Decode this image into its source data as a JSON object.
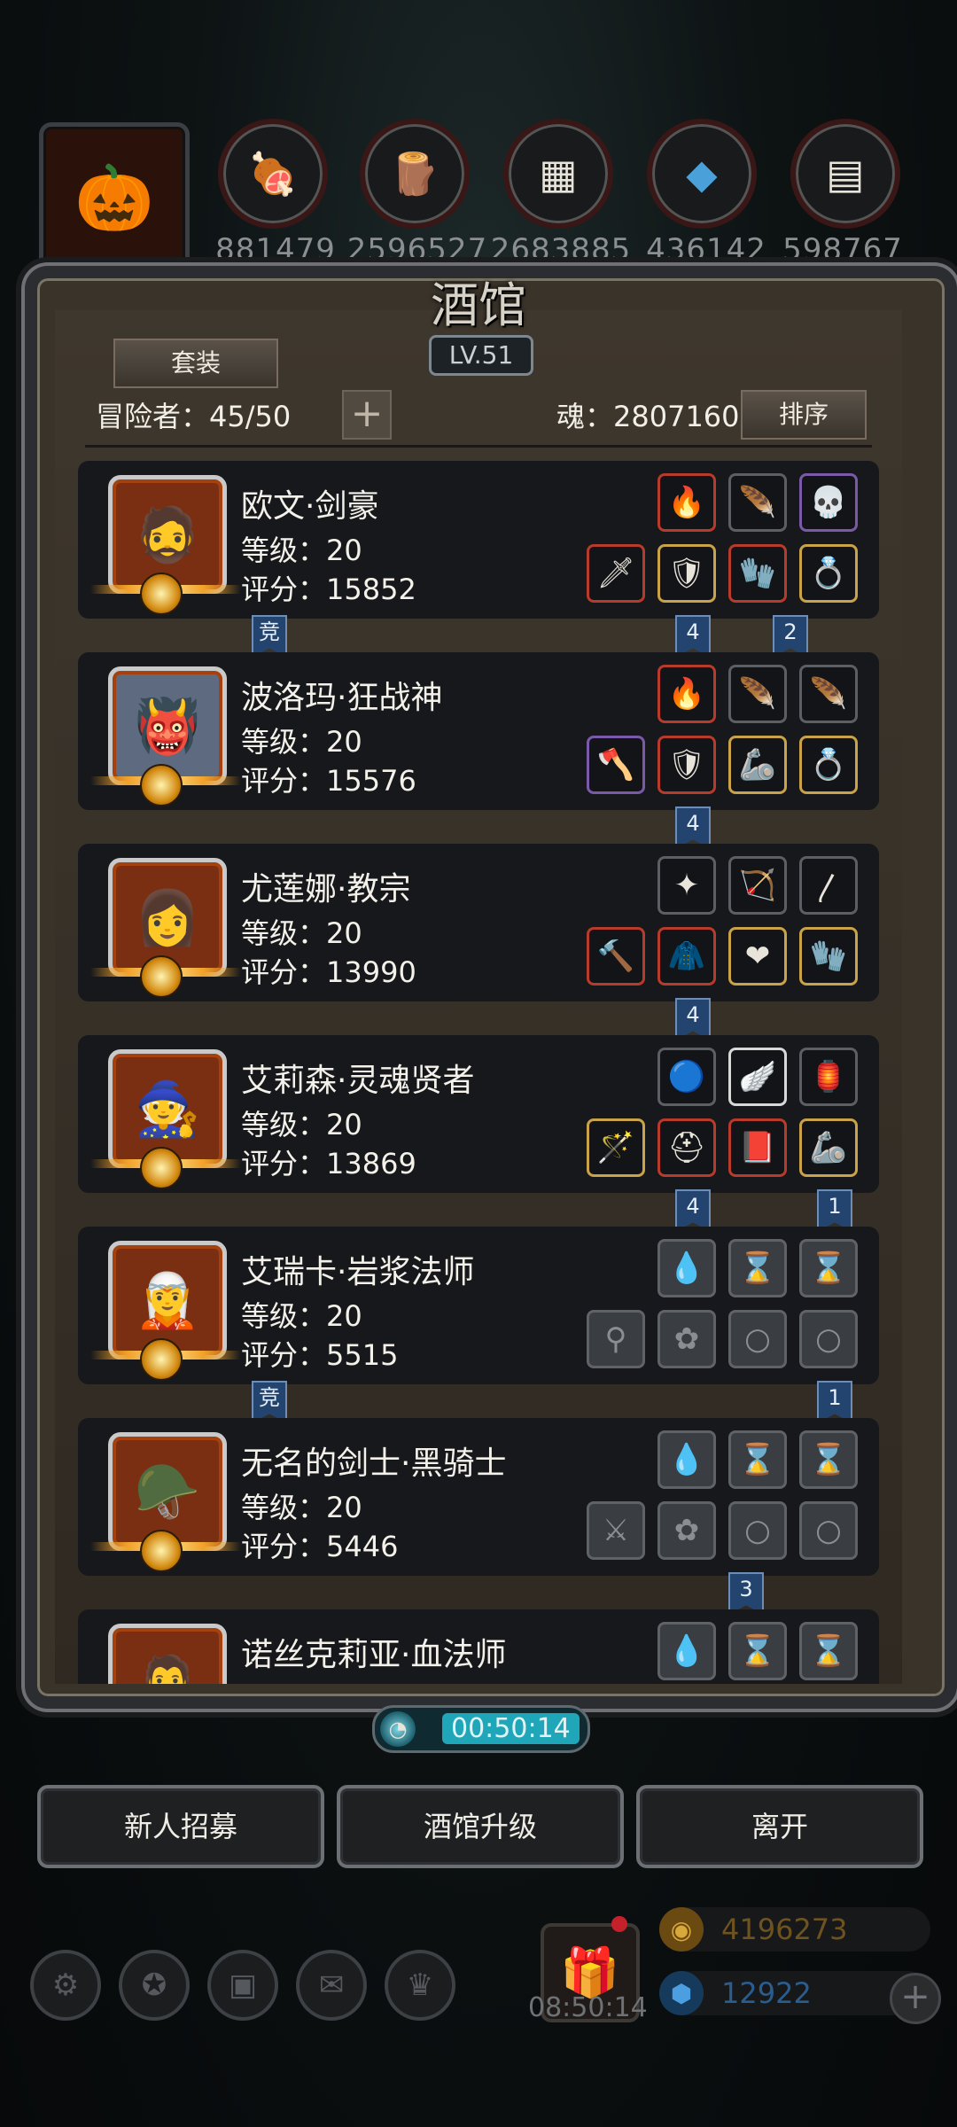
{
  "header": {
    "resources": [
      {
        "icon": "meat-icon",
        "value": "881479"
      },
      {
        "icon": "wood-icon",
        "value": "2596527"
      },
      {
        "icon": "stone-icon",
        "value": "2683885"
      },
      {
        "icon": "crystal-icon",
        "value": "436142"
      },
      {
        "icon": "iron-icon",
        "value": "598767"
      }
    ]
  },
  "tavern": {
    "title": "酒馆",
    "level": "LV.51",
    "suit_button": "套装",
    "adventurers": "冒险者：45/50",
    "plus": "+",
    "soul": "魂：2807160",
    "sort_button": "排序"
  },
  "heroes": [
    {
      "name": "欧文·剑豪",
      "level": "等级：20",
      "score": "评分：15852"
    },
    {
      "name": "波洛玛·狂战神",
      "level": "等级：20",
      "score": "评分：15576"
    },
    {
      "name": "尤莲娜·教宗",
      "level": "等级：20",
      "score": "评分：13990"
    },
    {
      "name": "艾莉森·灵魂贤者",
      "level": "等级：20",
      "score": "评分：13869"
    },
    {
      "name": "艾瑞卡·岩浆法师",
      "level": "等级：20",
      "score": "评分：5515"
    },
    {
      "name": "无名的剑士·黑骑士",
      "level": "等级：20",
      "score": "评分：5446"
    },
    {
      "name": "诺丝克莉亚·血法师",
      "level": "",
      "score": ""
    }
  ],
  "ribbons": {
    "r1a": "竞",
    "r1b": "4",
    "r1c": "2",
    "r2a": "4",
    "r3a": "4",
    "r4a": "4",
    "r4b": "1",
    "r5a": "竞",
    "r5b": "1",
    "r6a": "3"
  },
  "timer": "00:50:14",
  "buttons": {
    "recruit": "新人招募",
    "upgrade": "酒馆升级",
    "leave": "离开"
  },
  "footer": {
    "gift_timer": "08:50:14",
    "gold": "4196273",
    "gems": "12922",
    "add": "+"
  },
  "colors": {
    "gold_text": "#6e5320",
    "gem_text": "#2a5d8f"
  }
}
